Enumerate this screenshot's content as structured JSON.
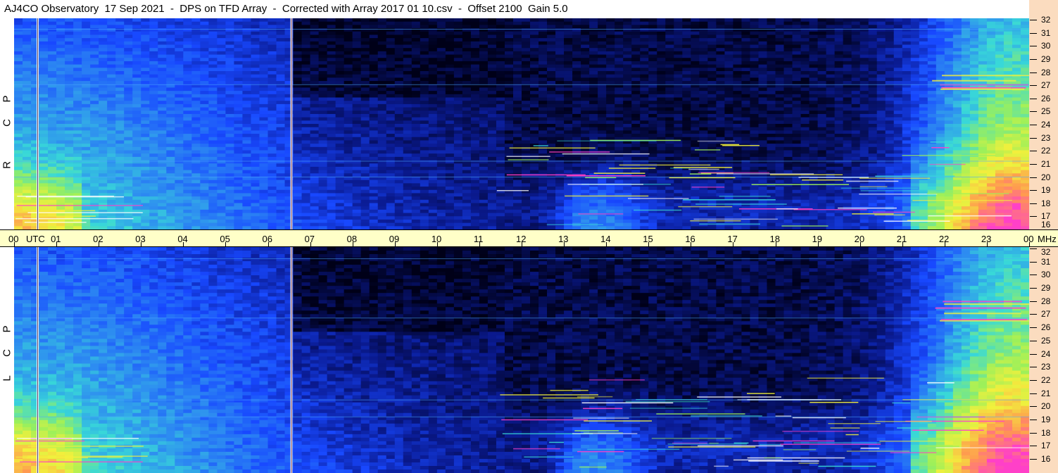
{
  "header": {
    "title": "AJ4CO Observatory  17 Sep 2021  -  DPS on TFD Array  -  Corrected with Array 2017 01 10.csv  -  Offset 2100  Gain 5.0"
  },
  "panels": [
    {
      "id": "rcp",
      "letters": [
        "R",
        "C",
        "P"
      ]
    },
    {
      "id": "lcp",
      "letters": [
        "L",
        "C",
        "P"
      ]
    }
  ],
  "time_axis": {
    "labels": [
      "00",
      "01",
      "02",
      "03",
      "04",
      "05",
      "06",
      "07",
      "08",
      "09",
      "10",
      "11",
      "12",
      "13",
      "14",
      "15",
      "16",
      "17",
      "18",
      "19",
      "20",
      "21",
      "22",
      "23",
      "00"
    ],
    "utc_label": "UTC",
    "mhz_label": "MHz"
  },
  "freq_axis": {
    "labels": [
      "32",
      "31",
      "30",
      "29",
      "28",
      "27",
      "26",
      "25",
      "24",
      "23",
      "22",
      "21",
      "20",
      "19",
      "18",
      "17",
      "16"
    ]
  },
  "chart_data": {
    "type": "heatmap",
    "title": "AJ4CO Observatory  17 Sep 2021  -  DPS on TFD Array  -  Corrected with Array 2017 01 10.csv  -  Offset 2100  Gain 5.0",
    "x": [
      "00",
      "01",
      "02",
      "03",
      "04",
      "05",
      "06",
      "07",
      "08",
      "09",
      "10",
      "11",
      "12",
      "13",
      "14",
      "15",
      "16",
      "17",
      "18",
      "19",
      "20",
      "21",
      "22",
      "23",
      "00"
    ],
    "y": [
      16,
      17,
      18,
      19,
      20,
      21,
      22,
      23,
      24,
      25,
      26,
      27,
      28,
      29,
      30,
      31,
      32
    ],
    "xlabel": "UTC",
    "ylabel": "MHz",
    "xlim": [
      0,
      24
    ],
    "ylim": [
      16,
      32
    ],
    "series": [
      {
        "name": "RCP"
      },
      {
        "name": "LCP"
      }
    ],
    "colormap": [
      "#000018",
      "#0a1a90",
      "#1848ff",
      "#2e8ff0",
      "#38d8d8",
      "#9cf05a",
      "#f2f03c",
      "#ff9850",
      "#ff40c8"
    ],
    "vertical_lines_utc": [
      0.55,
      6.55
    ]
  }
}
